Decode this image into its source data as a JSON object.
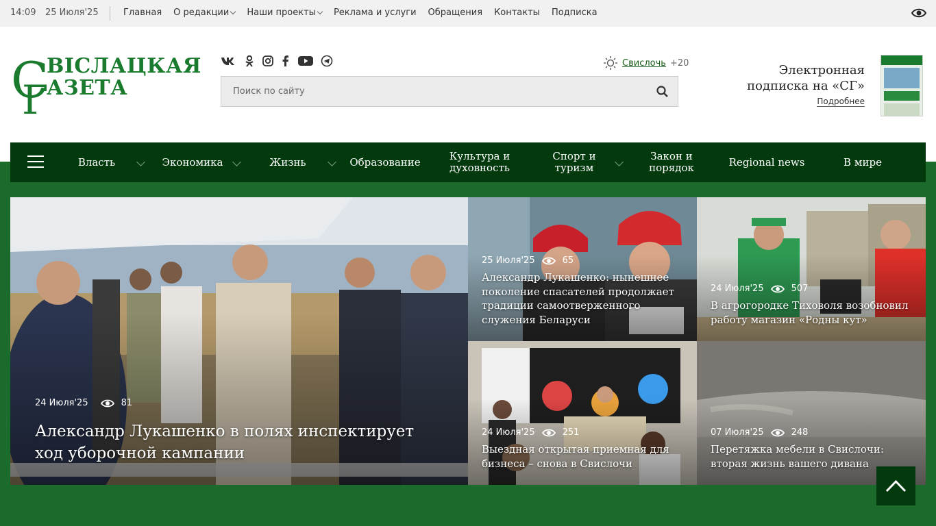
{
  "topbar": {
    "time": "14:09",
    "date": "25 Июля'25",
    "menu": [
      "Главная",
      "О редакции",
      "Наши проекты",
      "Реклама и услуги",
      "Обращения",
      "Контакты",
      "Подписка"
    ]
  },
  "logo": {
    "line1": "ВІСЛАЦКАЯ",
    "line2": "АЗЕТА",
    "initial1": "С",
    "initial2": "Г"
  },
  "search": {
    "placeholder": "Поиск по сайту"
  },
  "weather": {
    "city": "Свислочь",
    "temp": "+20"
  },
  "promo": {
    "line1": "Электронная",
    "line2": "подписка на «СГ»",
    "more": "Подробнее"
  },
  "nav": {
    "items": [
      "Власть",
      "Экономика",
      "Жизнь",
      "Образование",
      "Культура и духовность",
      "Спорт и туризм",
      "Закон и порядок",
      "Regional news",
      "В мире"
    ]
  },
  "news": [
    {
      "date": "24 Июля'25",
      "views": "81",
      "title": "Александр Лукашенко в полях инспектирует ход уборочной кампании"
    },
    {
      "date": "25 Июля'25",
      "views": "65",
      "title": "Александр Лукашенко: нынешнее поколение спасателей продолжает традиции самоотверженного служения Беларуси"
    },
    {
      "date": "24 Июля'25",
      "views": "507",
      "title": "В агрогородке Тиховоля возобновил работу магазин «Родны кут»"
    },
    {
      "date": "24 Июля'25",
      "views": "251",
      "title": "Выездная открытая приемная для бизнеса – снова в Свислочи"
    },
    {
      "date": "07 Июля'25",
      "views": "248",
      "title": "Перетяжка мебели в Свислочи: вторая жизнь вашего дивана"
    }
  ],
  "colors": {
    "brand": "#1a6b2c",
    "nav": "#033a0d"
  }
}
